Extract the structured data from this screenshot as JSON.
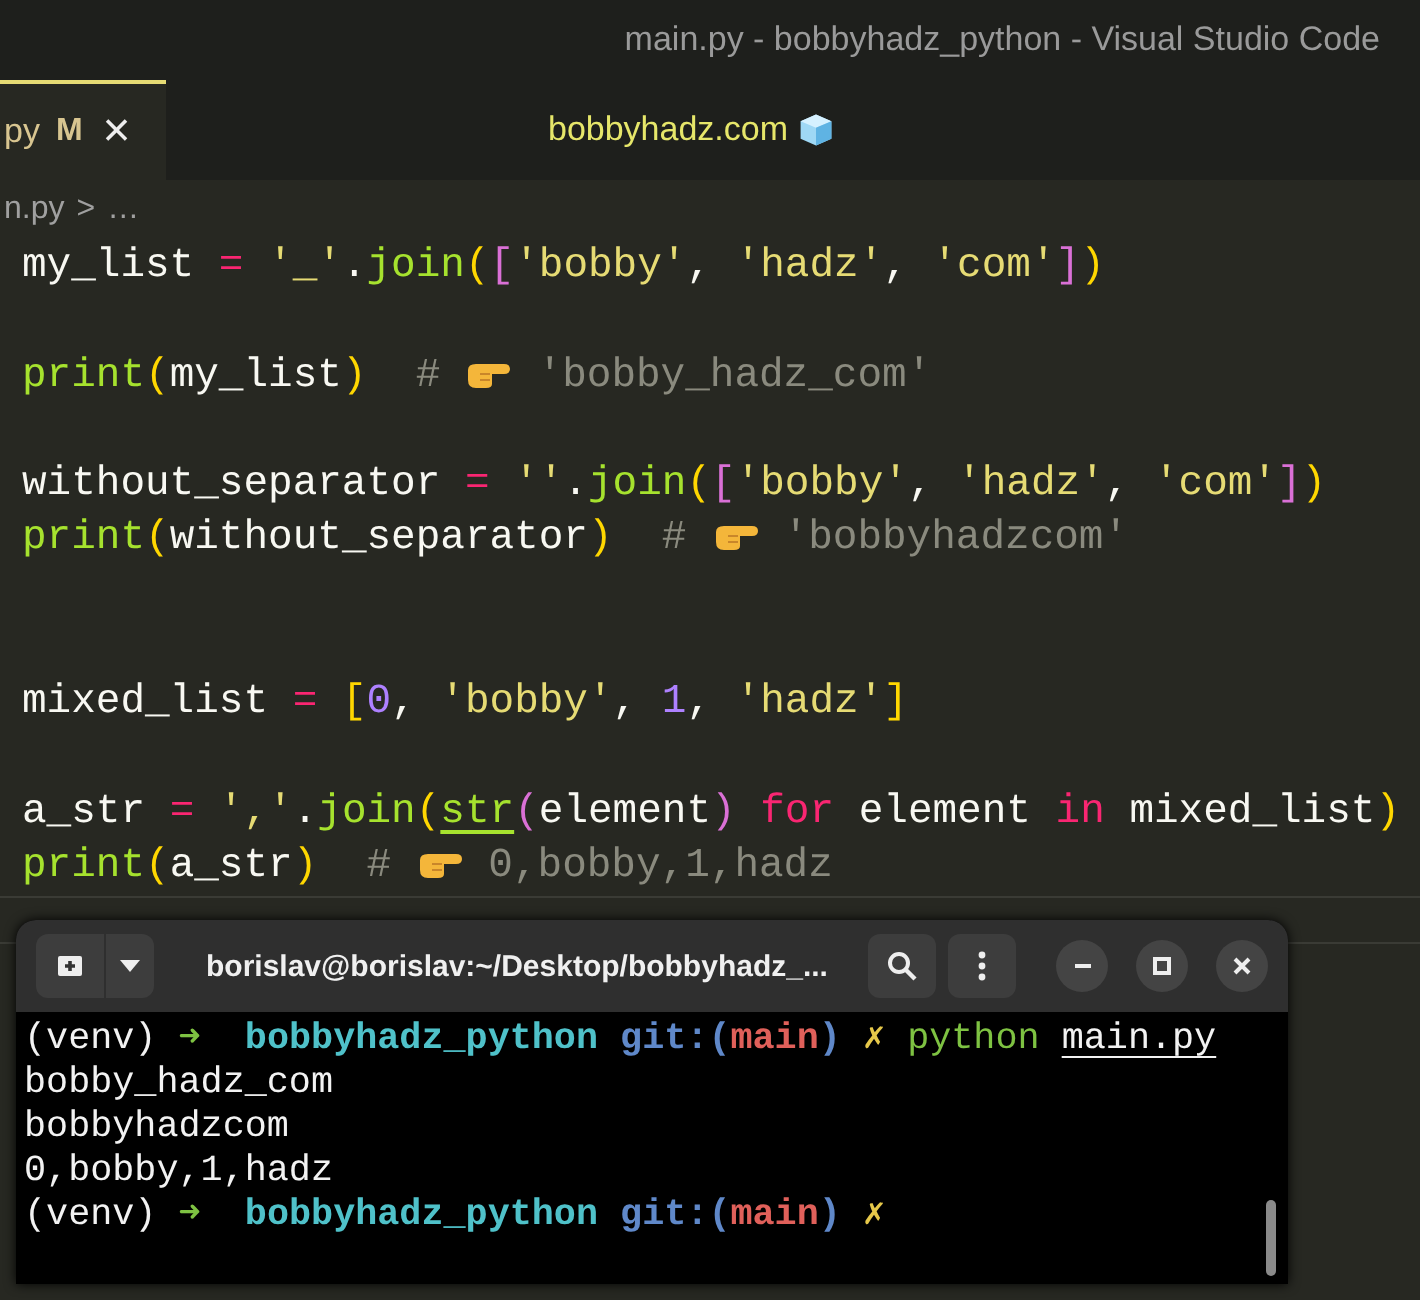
{
  "window": {
    "title": "main.py - bobbyhadz_python - Visual Studio Code"
  },
  "tab": {
    "label": "py",
    "badge": "M",
    "close": "×",
    "selected": true
  },
  "banner": {
    "text": "bobbyhadz.com"
  },
  "breadcrumb": {
    "file": "n.py",
    "separator": ">",
    "more": "…"
  },
  "code": [
    {
      "kind": "flush",
      "lines": [
        [
          {
            "kind": "text",
            "text": "my_list",
            "color": "#f8f8f2"
          },
          {
            "kind": "text",
            "text": " = ",
            "color": "#f92672"
          },
          {
            "kind": "text",
            "text": "'_'",
            "color": "#e6db74"
          },
          {
            "kind": "text",
            "text": ".",
            "color": "#f8f8f2"
          },
          {
            "kind": "text",
            "text": "join",
            "color": "#a6e22e"
          },
          {
            "kind": "text",
            "text": "(",
            "color": "#ffd700"
          },
          {
            "kind": "text",
            "text": "[",
            "color": "#da70d6"
          },
          {
            "kind": "text",
            "text": "'bobby'",
            "color": "#e6db74"
          },
          {
            "kind": "text",
            "text": ", ",
            "color": "#f8f8f2"
          },
          {
            "kind": "text",
            "text": "'hadz'",
            "color": "#e6db74"
          },
          {
            "kind": "text",
            "text": ", ",
            "color": "#f8f8f2"
          },
          {
            "kind": "text",
            "text": "'com'",
            "color": "#e6db74"
          },
          {
            "kind": "text",
            "text": "]",
            "color": "#da70d6"
          },
          {
            "kind": "text",
            "text": ")",
            "color": "#ffd700"
          }
        ]
      ]
    },
    {
      "kind": "spaced",
      "lines": [
        [
          {
            "kind": "text",
            "text": "print",
            "color": "#a6e22e"
          },
          {
            "kind": "text",
            "text": "(",
            "color": "#ffd700"
          },
          {
            "kind": "text",
            "text": "my_list",
            "color": "#f8f8f2"
          },
          {
            "kind": "text",
            "text": ")",
            "color": "#ffd700"
          },
          {
            "kind": "text",
            "text": "  # ",
            "color": "#8a8a7e"
          },
          {
            "kind": "pointer"
          },
          {
            "kind": "text",
            "text": " 'bobby_hadz_com'",
            "color": "#8a8a7e"
          }
        ]
      ]
    },
    {
      "kind": "spaced",
      "lines": [
        [
          {
            "kind": "text",
            "text": "without_separator",
            "color": "#f8f8f2"
          },
          {
            "kind": "text",
            "text": " = ",
            "color": "#f92672"
          },
          {
            "kind": "text",
            "text": "''",
            "color": "#e6db74"
          },
          {
            "kind": "text",
            "text": ".",
            "color": "#f8f8f2"
          },
          {
            "kind": "text",
            "text": "join",
            "color": "#a6e22e"
          },
          {
            "kind": "text",
            "text": "(",
            "color": "#ffd700"
          },
          {
            "kind": "text",
            "text": "[",
            "color": "#da70d6"
          },
          {
            "kind": "text",
            "text": "'bobby'",
            "color": "#e6db74"
          },
          {
            "kind": "text",
            "text": ", ",
            "color": "#f8f8f2"
          },
          {
            "kind": "text",
            "text": "'hadz'",
            "color": "#e6db74"
          },
          {
            "kind": "text",
            "text": ", ",
            "color": "#f8f8f2"
          },
          {
            "kind": "text",
            "text": "'com'",
            "color": "#e6db74"
          },
          {
            "kind": "text",
            "text": "]",
            "color": "#da70d6"
          },
          {
            "kind": "text",
            "text": ")",
            "color": "#ffd700"
          }
        ],
        [
          {
            "kind": "text",
            "text": "print",
            "color": "#a6e22e"
          },
          {
            "kind": "text",
            "text": "(",
            "color": "#ffd700"
          },
          {
            "kind": "text",
            "text": "without_separator",
            "color": "#f8f8f2"
          },
          {
            "kind": "text",
            "text": ")",
            "color": "#ffd700"
          },
          {
            "kind": "text",
            "text": "  # ",
            "color": "#8a8a7e"
          },
          {
            "kind": "pointer"
          },
          {
            "kind": "text",
            "text": " 'bobbyhadzcom'",
            "color": "#8a8a7e"
          }
        ]
      ]
    },
    {
      "kind": "wide",
      "lines": [
        [
          {
            "kind": "text",
            "text": "mixed_list",
            "color": "#f8f8f2"
          },
          {
            "kind": "text",
            "text": " = ",
            "color": "#f92672"
          },
          {
            "kind": "text",
            "text": "[",
            "color": "#ffd700"
          },
          {
            "kind": "text",
            "text": "0",
            "color": "#ae81ff"
          },
          {
            "kind": "text",
            "text": ", ",
            "color": "#f8f8f2"
          },
          {
            "kind": "text",
            "text": "'bobby'",
            "color": "#e6db74"
          },
          {
            "kind": "text",
            "text": ", ",
            "color": "#f8f8f2"
          },
          {
            "kind": "text",
            "text": "1",
            "color": "#ae81ff"
          },
          {
            "kind": "text",
            "text": ", ",
            "color": "#f8f8f2"
          },
          {
            "kind": "text",
            "text": "'hadz'",
            "color": "#e6db74"
          },
          {
            "kind": "text",
            "text": "]",
            "color": "#ffd700"
          }
        ]
      ]
    },
    {
      "kind": "spaced",
      "lines": [
        [
          {
            "kind": "text",
            "text": "a_str",
            "color": "#f8f8f2"
          },
          {
            "kind": "text",
            "text": " = ",
            "color": "#f92672"
          },
          {
            "kind": "text",
            "text": "','",
            "color": "#e6db74"
          },
          {
            "kind": "text",
            "text": ".",
            "color": "#f8f8f2"
          },
          {
            "kind": "text",
            "text": "join",
            "color": "#a6e22e"
          },
          {
            "kind": "text",
            "text": "(",
            "color": "#ffd700"
          },
          {
            "kind": "text",
            "text": "str",
            "color": "#a6e22e",
            "underlined": true
          },
          {
            "kind": "text",
            "text": "(",
            "color": "#da70d6"
          },
          {
            "kind": "text",
            "text": "element",
            "color": "#f8f8f2"
          },
          {
            "kind": "text",
            "text": ")",
            "color": "#da70d6"
          },
          {
            "kind": "text",
            "text": " for ",
            "color": "#f92672"
          },
          {
            "kind": "text",
            "text": "element",
            "color": "#f8f8f2"
          },
          {
            "kind": "text",
            "text": " in ",
            "color": "#f92672"
          },
          {
            "kind": "text",
            "text": "mixed_list",
            "color": "#f8f8f2"
          },
          {
            "kind": "text",
            "text": ")",
            "color": "#ffd700"
          }
        ],
        [
          {
            "kind": "text",
            "text": "print",
            "color": "#a6e22e"
          },
          {
            "kind": "text",
            "text": "(",
            "color": "#ffd700"
          },
          {
            "kind": "text",
            "text": "a_str",
            "color": "#f8f8f2"
          },
          {
            "kind": "text",
            "text": ")",
            "color": "#ffd700"
          },
          {
            "kind": "text",
            "text": "  # ",
            "color": "#8a8a7e"
          },
          {
            "kind": "pointer"
          },
          {
            "kind": "text",
            "text": " 0,bobby,1,hadz",
            "color": "#8a8a7e"
          }
        ]
      ]
    }
  ],
  "terminal": {
    "title": "borislav@borislav:~/Desktop/bobbyhadz_...",
    "lines": [
      [
        {
          "text": "(venv) ",
          "color": "#f2f2f2"
        },
        {
          "text": "➜  ",
          "color": "#7ec242"
        },
        {
          "text": "bobbyhadz_python ",
          "color": "#4fc1c9",
          "bold": true
        },
        {
          "text": "git:(",
          "color": "#5f88c9",
          "bold": true
        },
        {
          "text": "main",
          "color": "#e0605a",
          "bold": true
        },
        {
          "text": ") ",
          "color": "#5f88c9",
          "bold": true
        },
        {
          "text": "✗ ",
          "color": "#e6c84a"
        },
        {
          "text": "python ",
          "color": "#7ec242"
        },
        {
          "text": "main.py",
          "color": "#f2f2f2",
          "underlined": true
        }
      ],
      [
        {
          "text": "bobby_hadz_com",
          "color": "#f2f2f2"
        }
      ],
      [
        {
          "text": "bobbyhadzcom",
          "color": "#f2f2f2"
        }
      ],
      [
        {
          "text": "0,bobby,1,hadz",
          "color": "#f2f2f2"
        }
      ],
      [
        {
          "text": "(venv) ",
          "color": "#f2f2f2"
        },
        {
          "text": "➜  ",
          "color": "#7ec242"
        },
        {
          "text": "bobbyhadz_python ",
          "color": "#4fc1c9",
          "bold": true
        },
        {
          "text": "git:(",
          "color": "#5f88c9",
          "bold": true
        },
        {
          "text": "main",
          "color": "#e0605a",
          "bold": true
        },
        {
          "text": ") ",
          "color": "#5f88c9",
          "bold": true
        },
        {
          "text": "✗",
          "color": "#e6c84a"
        }
      ]
    ]
  }
}
